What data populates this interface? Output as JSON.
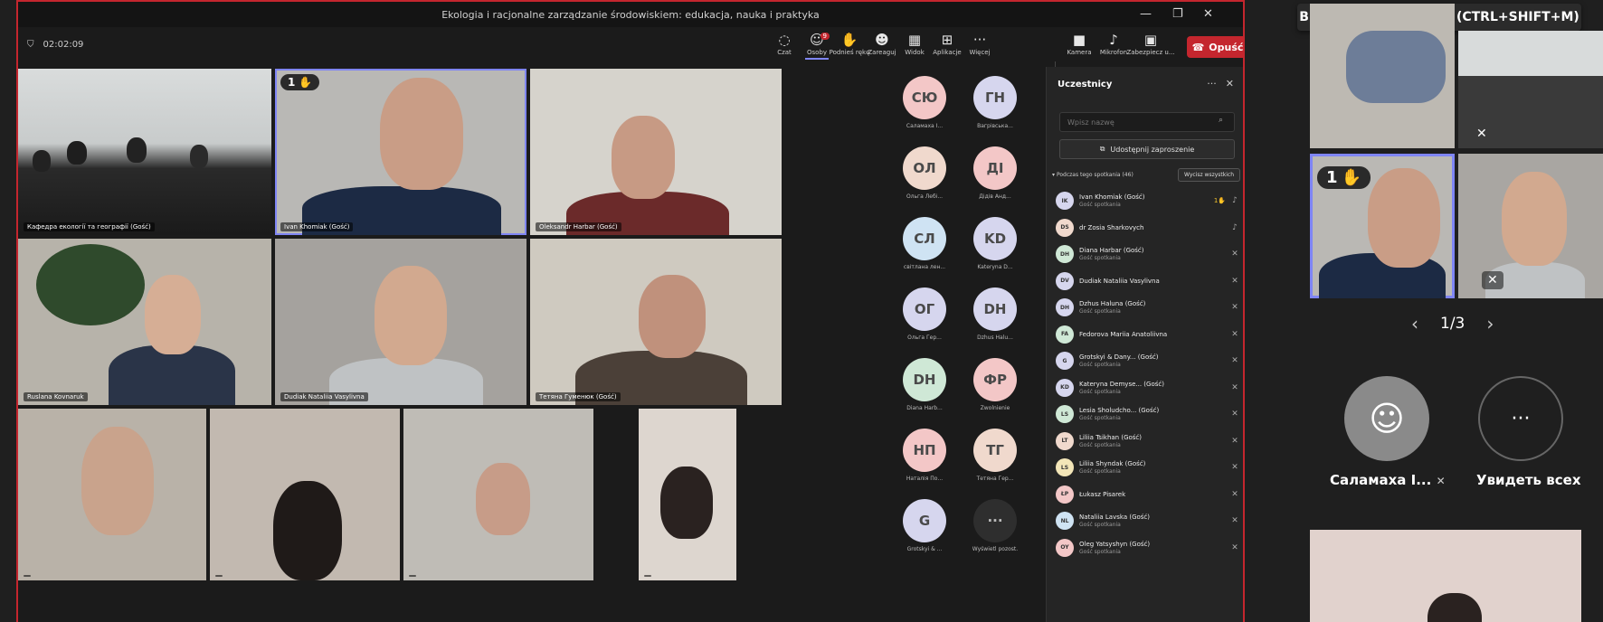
{
  "window": {
    "title": "Ekologia i racjonalne zarządzanie środowiskiem: edukacja, nauka i praktyka",
    "timer": "02:02:09"
  },
  "toolbar": {
    "chat": "Czat",
    "people": "Osoby",
    "people_badge": "9",
    "raise_hand": "Podnieś rękę",
    "react": "Zareaguj",
    "view": "Widok",
    "apps": "Aplikacje",
    "more": "Więcej",
    "camera": "Kamera",
    "mic": "Mikrofon",
    "share": "Zabezpiecz u...",
    "leave": "Opuść"
  },
  "tiles": [
    {
      "name": "Кафедра екології та географії (Gość)"
    },
    {
      "name": "Ivan Khomiak (Gość)",
      "hand": "1"
    },
    {
      "name": "Oleksandr Harbar (Gość)"
    },
    {
      "name": "Ruslana Kovnaruk"
    },
    {
      "name": "Dudiak Nataliia Vasylivna"
    },
    {
      "name": "Тетяна Гуменюк (Gość)"
    },
    {
      "name": ""
    },
    {
      "name": ""
    },
    {
      "name": ""
    },
    {
      "name": ""
    }
  ],
  "gallery": [
    {
      "initials": "СЮ",
      "name": "Саламаха І...",
      "color": "#f3c7c7"
    },
    {
      "initials": "ГН",
      "name": "Вагрівська...",
      "color": "#d6d6ee"
    },
    {
      "initials": "ОЛ",
      "name": "Ольга Лебі...",
      "color": "#f0d9cd"
    },
    {
      "initials": "ДІ",
      "name": "Дідів Анд...",
      "color": "#f3c7c7"
    },
    {
      "initials": "СЛ",
      "name": "світлана лен...",
      "color": "#cfe3f3"
    },
    {
      "initials": "KD",
      "name": "Kateryna D...",
      "color": "#d6d6ee"
    },
    {
      "initials": "ОГ",
      "name": "Ольга Гер...",
      "color": "#d6d6ee"
    },
    {
      "initials": "DH",
      "name": "Dzhus Halu...",
      "color": "#d6d6ee"
    },
    {
      "initials": "DH",
      "name": "Diana Harb...",
      "color": "#cfe8d6"
    },
    {
      "initials": "ФР",
      "name": "Zwolnienie",
      "color": "#f3c7c7"
    },
    {
      "initials": "НП",
      "name": "Наталія По...",
      "color": "#f3c7c7"
    },
    {
      "initials": "ТГ",
      "name": "Тетяна Гер...",
      "color": "#f0d9cd"
    },
    {
      "initials": "G",
      "name": "Grotskyi & ...",
      "color": "#d6d6ee"
    },
    {
      "initials": "···",
      "name": "Wyświetl pozost.",
      "color": "#2e2e2e"
    }
  ],
  "panel": {
    "title": "Uczestnicy",
    "search_placeholder": "Wpisz nazwę",
    "invite": "Udostępnij zaproszenie",
    "group": "Podczas tego spotkania (46)",
    "mute_all": "Wycisz wszystkich",
    "participants": [
      {
        "initials": "IK",
        "name": "Ivan Khomiak (Gość)",
        "role": "Gość spotkania",
        "color": "#d6d6ee",
        "hand": "1"
      },
      {
        "initials": "DS",
        "name": "dr Zosia Sharkovych",
        "role": "",
        "color": "#f0d9cd"
      },
      {
        "initials": "DH",
        "name": "Diana Harbar (Gość)",
        "role": "Gość spotkania",
        "color": "#cfe8d6"
      },
      {
        "initials": "DV",
        "name": "Dudiak Nataliia Vasylivna",
        "role": "",
        "color": "#d6d6ee"
      },
      {
        "initials": "DH",
        "name": "Dzhus Haluna (Gość)",
        "role": "Gość spotkania",
        "color": "#d6d6ee"
      },
      {
        "initials": "FA",
        "name": "Fedorova Mariia Anatoliivna",
        "role": "",
        "color": "#cfe8d6"
      },
      {
        "initials": "G",
        "name": "Grotskyi & Dany... (Gość)",
        "role": "Gość spotkania",
        "color": "#d6d6ee"
      },
      {
        "initials": "KD",
        "name": "Kateryna Demyse... (Gość)",
        "role": "Gość spotkania",
        "color": "#d6d6ee"
      },
      {
        "initials": "LS",
        "name": "Lesia Sholudcho... (Gość)",
        "role": "Gość spotkania",
        "color": "#cfe8d6"
      },
      {
        "initials": "LT",
        "name": "Liliia Tsikhan (Gość)",
        "role": "Gość spotkania",
        "color": "#f0d9cd"
      },
      {
        "initials": "LS",
        "name": "Liliia Shyndak (Gość)",
        "role": "Gość spotkania",
        "color": "#f3e6b8"
      },
      {
        "initials": "ŁP",
        "name": "Łukasz Pisarek",
        "role": "",
        "color": "#f3c7c7"
      },
      {
        "initials": "NL",
        "name": "Nataliia Lavska (Gość)",
        "role": "Gość spotkania",
        "color": "#cfe3f3"
      },
      {
        "initials": "OY",
        "name": "Oleg Yatsyshyn (Gość)",
        "role": "Gość spotkania",
        "color": "#f3c7c7"
      }
    ]
  },
  "side": {
    "tooltip": "Включить микрофон (CTRL+SHIFT+M)",
    "hand": "1",
    "pager": "1/3",
    "self_name": "Саламаха І...",
    "see_all": "Увидеть всех"
  }
}
